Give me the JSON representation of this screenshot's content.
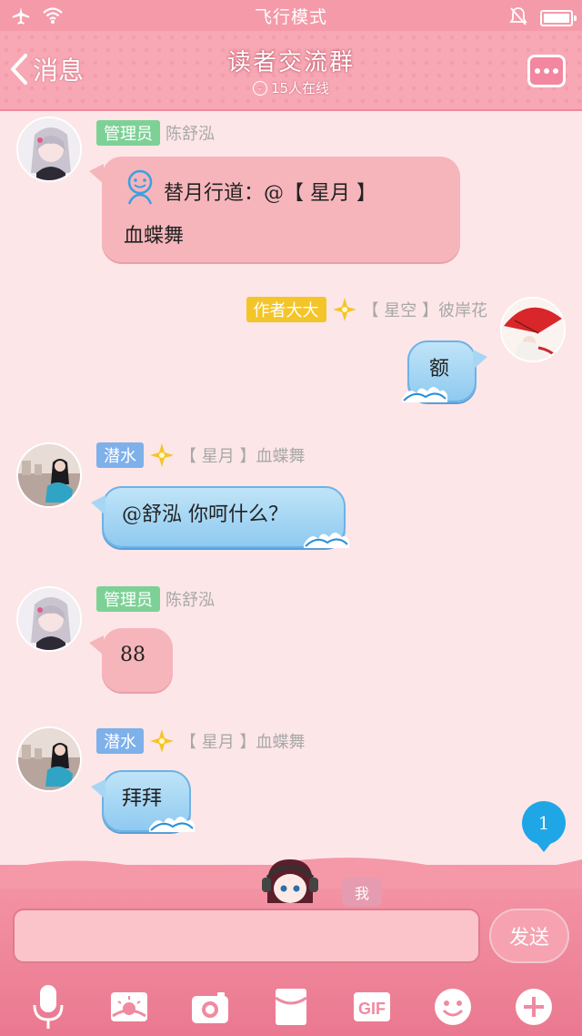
{
  "status_bar": {
    "mode_text": "飞行模式"
  },
  "header": {
    "back_label": "消息",
    "title": "读者交流群",
    "online_text": "15人在线"
  },
  "messages": [
    {
      "role": "管理员",
      "name": "陈舒泓",
      "text_line1": "替月行道：@【 星月 】",
      "text_line2": "血蝶舞",
      "style": "pink",
      "side": "left"
    },
    {
      "role": "作者大大",
      "name": "【 星空 】彼岸花",
      "text": "额",
      "style": "blue",
      "side": "right"
    },
    {
      "role": "潜水",
      "name": "【 星月 】血蝶舞",
      "text": "@舒泓 你呵什么？",
      "style": "blue",
      "side": "left"
    },
    {
      "role": "管理员",
      "name": "陈舒泓",
      "text": "88",
      "style": "pink",
      "side": "left"
    },
    {
      "role": "潜水",
      "name": "【 星月 】血蝶舞",
      "text": "拜拜",
      "style": "blue",
      "side": "left"
    }
  ],
  "unread_count": "1",
  "composer": {
    "me_label": "我",
    "send_label": "发送",
    "input_value": ""
  },
  "toolbar": {
    "gif_label": "GIF",
    "icons": [
      "microphone-icon",
      "image-icon",
      "camera-icon",
      "red-envelope-icon",
      "gif-icon",
      "emoji-icon",
      "plus-icon"
    ]
  },
  "colors": {
    "header_pink": "#f7a8b4",
    "admin_badge": "#7ed196",
    "diver_badge": "#7eb0ea",
    "author_badge": "#f4c528",
    "pink_bubble": "#f6b5bb",
    "blue_bubble": "#a6d6f4",
    "unread_badge": "#1fa6e6"
  }
}
